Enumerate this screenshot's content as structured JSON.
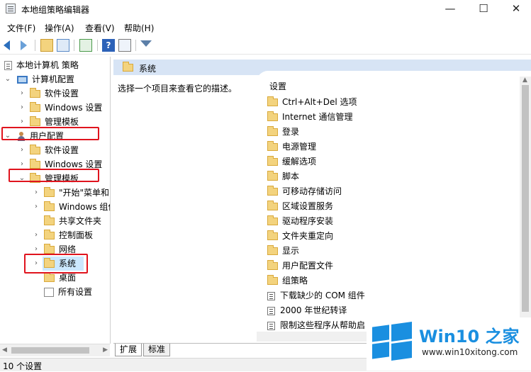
{
  "window": {
    "title": "本地组策略编辑器",
    "minimize": "—",
    "maximize": "☐",
    "close": "✕"
  },
  "menu": [
    {
      "label": "文件(F)"
    },
    {
      "label": "操作(A)"
    },
    {
      "label": "查看(V)"
    },
    {
      "label": "帮助(H)"
    }
  ],
  "tree": {
    "root": "本地计算机 策略",
    "computer_config": "计算机配置",
    "computer_children": [
      "软件设置",
      "Windows 设置",
      "管理模板"
    ],
    "user_config": "用户配置",
    "user_children": [
      "软件设置",
      "Windows 设置"
    ],
    "admin_templates": "管理模板",
    "admin_children": [
      "\"开始\"菜单和",
      "Windows 组件",
      "共享文件夹",
      "控制面板",
      "网络",
      "系统",
      "桌面",
      "所有设置"
    ]
  },
  "details": {
    "header": "系统",
    "description": "选择一个项目来查看它的描述。",
    "column_header": "设置",
    "folders": [
      "Ctrl+Alt+Del 选项",
      "Internet 通信管理",
      "登录",
      "电源管理",
      "缓解选项",
      "脚本",
      "可移动存储访问",
      "区域设置服务",
      "驱动程序安装",
      "文件夹重定向",
      "显示",
      "用户配置文件",
      "组策略"
    ],
    "policies": [
      "下载缺少的 COM 组件",
      "2000 年世纪转译",
      "限制这些程序从帮助启"
    ]
  },
  "tabs": [
    {
      "label": "扩展"
    },
    {
      "label": "标准"
    }
  ],
  "status": "10 个设置",
  "watermark": {
    "brand": "Win10 之家",
    "url": "www.win10xitong.com"
  },
  "colors": {
    "highlight_box": "#e0141e",
    "selection": "#cce8ff",
    "header_bg": "#d7e4f5",
    "brand": "#1a8fe0"
  }
}
